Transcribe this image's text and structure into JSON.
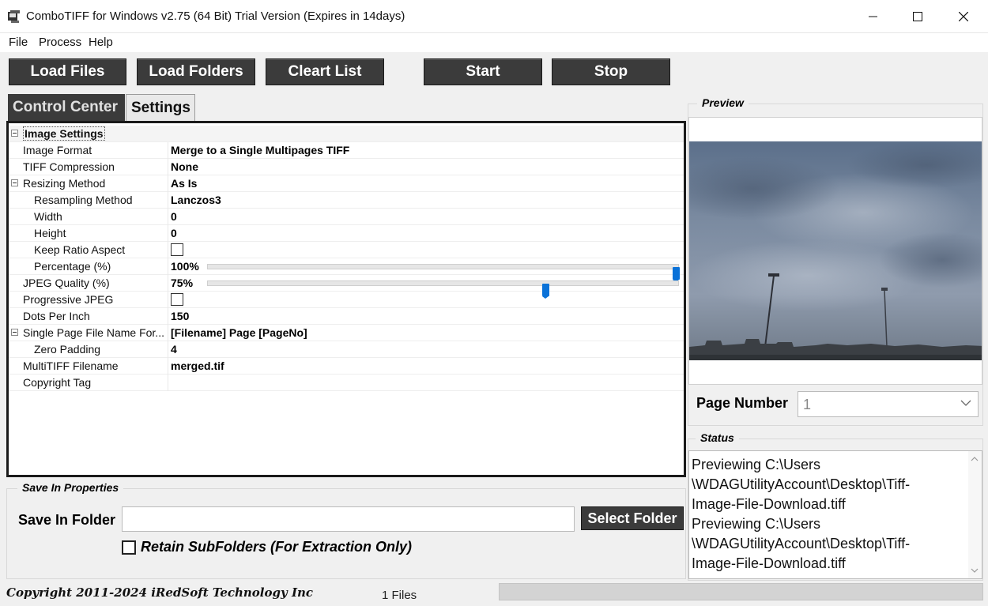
{
  "window": {
    "title": "ComboTIFF for Windows v2.75 (64 Bit)  Trial Version (Expires in 14days)"
  },
  "menu": [
    "File",
    "Process",
    "Help"
  ],
  "toolbar": {
    "load_files": "Load Files",
    "load_folders": "Load Folders",
    "clear_list": "Cleart List",
    "start": "Start",
    "stop": "Stop"
  },
  "tabs": {
    "control_center": "Control Center",
    "settings": "Settings"
  },
  "grid": {
    "section": "Image Settings",
    "rows": {
      "image_format": {
        "name": "Image Format",
        "value": "Merge to a Single Multipages TIFF"
      },
      "tiff_compression": {
        "name": "TIFF Compression",
        "value": "None"
      },
      "resizing_method": {
        "name": "Resizing Method",
        "value": "As Is"
      },
      "resampling_method": {
        "name": "Resampling Method",
        "value": "Lanczos3"
      },
      "width": {
        "name": "Width",
        "value": "0"
      },
      "height": {
        "name": "Height",
        "value": "0"
      },
      "keep_ratio": {
        "name": "Keep Ratio Aspect",
        "checked": false
      },
      "percentage": {
        "name": "Percentage (%)",
        "value": "100%",
        "level": 1.0
      },
      "jpeg_quality": {
        "name": "JPEG Quality (%)",
        "value": "75%",
        "level": 0.72
      },
      "progressive_jpeg": {
        "name": "Progressive JPEG",
        "checked": false
      },
      "dpi": {
        "name": "Dots Per Inch",
        "value": "150"
      },
      "single_page_name": {
        "name": "Single Page File Name For...",
        "value": "[Filename] Page [PageNo]"
      },
      "zero_padding": {
        "name": "Zero Padding",
        "value": "4"
      },
      "multitiff_filename": {
        "name": "MultiTIFF Filename",
        "value": "merged.tif"
      },
      "copyright_tag": {
        "name": "Copyright Tag",
        "value": ""
      }
    }
  },
  "save": {
    "legend": "Save In Properties",
    "label": "Save In Folder",
    "folder_value": "",
    "select_button": "Select Folder",
    "retain_label": "Retain SubFolders (For Extraction Only)",
    "retain_checked": false
  },
  "preview": {
    "legend": "Preview",
    "page_label": "Page Number",
    "page_value": "1"
  },
  "status": {
    "legend": "Status",
    "text": "Previewing C:\\Users\n\\WDAGUtilityAccount\\Desktop\\Tiff-\nImage-File-Download.tiff\nPreviewing C:\\Users\n\\WDAGUtilityAccount\\Desktop\\Tiff-\nImage-File-Download.tiff"
  },
  "footer": {
    "copyright": "Copyright 2011-2024 iRedSoft Technology Inc",
    "files": "1 Files",
    "progress": 0
  }
}
